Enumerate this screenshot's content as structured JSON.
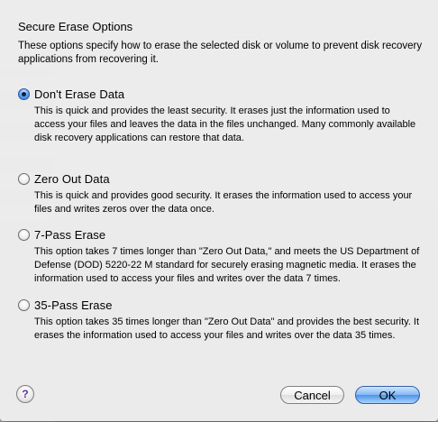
{
  "sheet": {
    "title": "Secure Erase Options",
    "description": "These options specify how to erase the selected disk or volume to prevent disk recovery applications from recovering it."
  },
  "options": [
    {
      "label": "Don't Erase Data",
      "selected": true,
      "description": "This is quick and provides the least security. It erases just the information used to access your files and leaves the data in the files unchanged. Many commonly available disk recovery applications can restore that data."
    },
    {
      "label": "Zero Out Data",
      "selected": false,
      "description": "This is quick and provides good security. It erases the information used to access your files and writes zeros over the data once."
    },
    {
      "label": "7-Pass Erase",
      "selected": false,
      "description": "This option takes 7 times longer than \"Zero Out Data,\" and meets the US Department of Defense (DOD) 5220-22 M standard for securely erasing magnetic media. It erases the information used to access your files and writes over the data 7 times."
    },
    {
      "label": "35-Pass Erase",
      "selected": false,
      "description": "This option takes 35 times longer than \"Zero Out Data\" and provides the best security. It erases the information used to access your files and writes over the data 35 times."
    }
  ],
  "footer": {
    "help_label": "?",
    "cancel_label": "Cancel",
    "ok_label": "OK"
  },
  "colors": {
    "selected_radio": "#2d6ed6",
    "default_button": "#4f93e6",
    "help_glyph": "#5a32a8"
  }
}
